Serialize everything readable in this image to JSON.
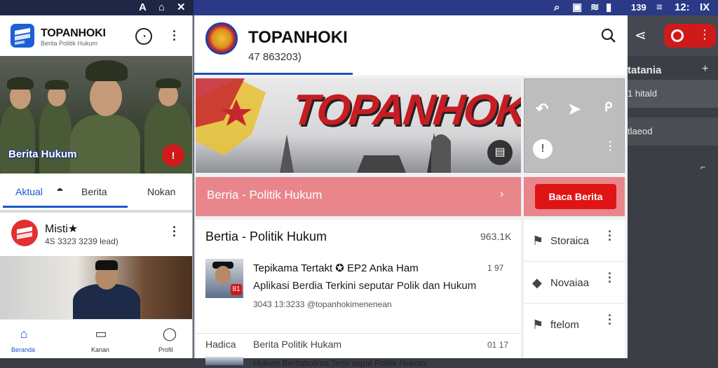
{
  "status_bar": {
    "left_icons": [
      "A",
      "⌂",
      "✕"
    ],
    "right_time": "12:",
    "right_num": "139",
    "right_extra": "IX"
  },
  "left_app": {
    "title": "TOPANHOKI",
    "subtitle": "Berita Politik Hukum",
    "hero_caption": "Berita Hukum",
    "tabs": [
      {
        "label": "Aktual"
      },
      {
        "label": "Berita"
      },
      {
        "label": "Nokan"
      }
    ],
    "card": {
      "title": "Misti★",
      "subtitle": "4S 3323 3239 lead)"
    },
    "nav": [
      {
        "label": "Beranda"
      },
      {
        "label": "Kanan"
      },
      {
        "label": "Profil"
      }
    ]
  },
  "main": {
    "title": "TOPANHOKI",
    "subtitle": "47 863203)",
    "banner_text": "TOPANHOKI",
    "strip_label": "Berria - Politik Hukum",
    "red_button": "Baca Berita",
    "feed": {
      "title": "Bertia - Politik Hukum",
      "count": "963.1K",
      "items": [
        {
          "title": "Tepikama Tertakt ✪ EP2 Anka Ham",
          "desc": "Aplikasi Berdia Terkini seputar Polik dan Hukum",
          "meta": "3043 13:3233  @topanhokimenenean",
          "time": "1 97"
        },
        {
          "section": "Hadica",
          "title": "Berita Politik Hukam",
          "desc": "Hukum Beritabolima Terbi sepat Politik Nekom",
          "time": "01 17"
        }
      ]
    },
    "side_list": [
      {
        "label": "Storaica"
      },
      {
        "label": "Novaiaa"
      },
      {
        "label": "ftelom"
      }
    ]
  },
  "right_panel": {
    "section_title": "tatania",
    "items": [
      {
        "label": "1 hitald"
      },
      {
        "label": "tlaeod"
      }
    ]
  },
  "colors": {
    "brand_blue": "#1b4fb8",
    "brand_red": "#d01a1a",
    "strip_pink": "#e9868c"
  }
}
